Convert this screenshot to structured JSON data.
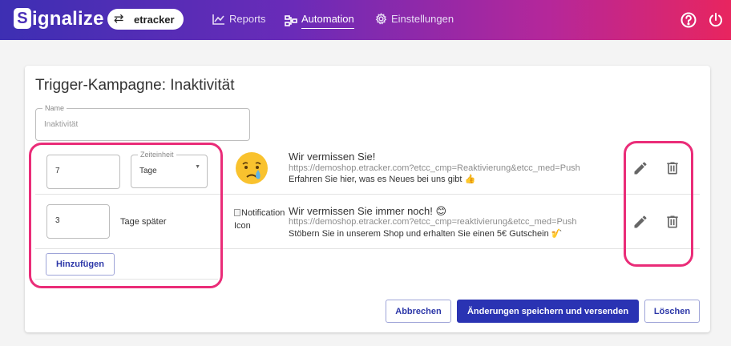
{
  "header": {
    "logo_text": "ignalize",
    "logo_letter": "S",
    "site_selector": {
      "icon": "swap-arrows-icon",
      "label": "etracker"
    },
    "nav": [
      {
        "label": "Reports",
        "icon": "chart-line-icon"
      },
      {
        "label": "Automation",
        "icon": "workflow-icon",
        "active": true
      },
      {
        "label": "Einstellungen",
        "icon": "gear-icon"
      }
    ],
    "help_icon": "help-circle-icon",
    "power_icon": "power-icon"
  },
  "campaign": {
    "title": "Trigger-Kampagne: Inaktivität",
    "name_field": {
      "label": "Name",
      "value": "Inaktivität"
    }
  },
  "steps": [
    {
      "delay_value": "7",
      "unit_label": "Zeiteinheit",
      "unit_value": "Tage",
      "image": "crying-face-emoji",
      "title": "Wir vermissen Sie!",
      "url": "https://demoshop.etracker.com?etcc_cmp=Reaktivierung&etcc_med=Push",
      "body": "Erfahren Sie hier, was es Neues bei uns gibt 👍"
    },
    {
      "delay_value": "3",
      "suffix": "Tage später",
      "image_alt_line1": "Notification",
      "image_alt_line2": "Icon",
      "title": "Wir vermissen Sie immer noch! 😊",
      "url": "https://demoshop.etracker.com?etcc_cmp=reaktivierung&etcc_med=Push",
      "body": "Stöbern Sie in unserem Shop und erhalten Sie einen 5€ Gutschein 🎷"
    }
  ],
  "add_button": "Hinzufügen",
  "footer": {
    "cancel": "Abbrechen",
    "save": "Änderungen speichern und versenden",
    "delete": "Löschen"
  },
  "colors": {
    "accent": "#2a33b3",
    "highlight": "#ea2c78",
    "gradient_start": "#3d2fb3",
    "gradient_end": "#e8255f"
  }
}
